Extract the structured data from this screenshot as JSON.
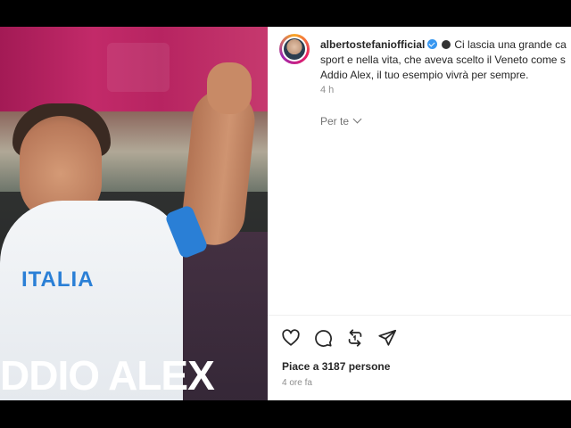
{
  "photo": {
    "overlay_title": "DDIO ALEX",
    "jersey_text": "ITALIA"
  },
  "post": {
    "username": "albertostefaniofficial",
    "caption_line1": "Ci lascia una grande ca",
    "caption_line2": "sport e nella vita, che aveva scelto il Veneto come s",
    "caption_line3": "Addio Alex, il tuo esempio vivrà per sempre.",
    "time": "4 h",
    "translation_label": "Per te",
    "likes": "Piace a 3187 persone",
    "ago": "4 ore fa"
  },
  "actions": [
    {
      "name": "heart-icon"
    },
    {
      "name": "comment-icon"
    },
    {
      "name": "repost-icon"
    },
    {
      "name": "share-icon"
    }
  ],
  "colors": {
    "accent_blue": "#3897f0",
    "text": "#262626",
    "muted": "#8e8e8e"
  }
}
